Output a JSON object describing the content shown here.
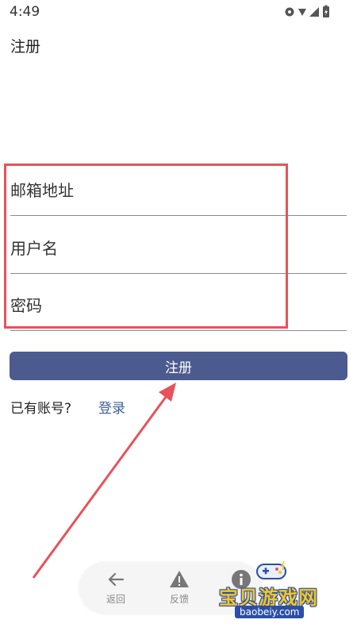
{
  "status_bar": {
    "time": "4:49"
  },
  "page_title": "注册",
  "form": {
    "email_placeholder": "邮箱地址",
    "username_placeholder": "用户名",
    "password_placeholder": "密码",
    "submit_label": "注册"
  },
  "login": {
    "prompt": "已有账号?",
    "link_label": "登录"
  },
  "bottom_bar": {
    "back_label": "返回",
    "feedback_label": "反馈"
  },
  "watermark": {
    "title": "宝贝游戏网",
    "url": "baobeiy.com"
  },
  "colors": {
    "accent": "#4c5b8f",
    "highlight": "#e8525a",
    "link": "#3e5f9e"
  }
}
